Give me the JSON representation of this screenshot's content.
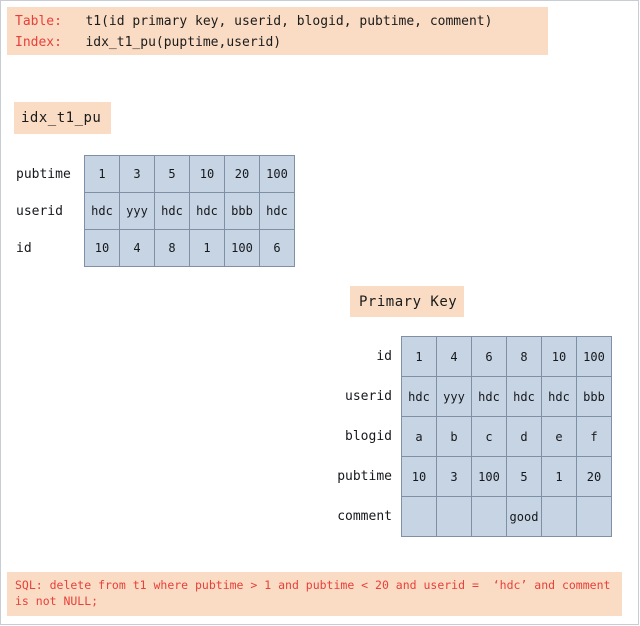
{
  "header": {
    "table_label": "Table:",
    "table_def": "t1(id primary key, userid, blogid, pubtime, comment)",
    "index_label": "Index:",
    "index_def": "idx_t1_pu(puptime,userid)"
  },
  "index_section": {
    "chip_label": "idx_t1_pu",
    "rows": [
      {
        "label": "pubtime",
        "values": [
          "1",
          "3",
          "5",
          "10",
          "20",
          "100"
        ]
      },
      {
        "label": "userid",
        "values": [
          "hdc",
          "yyy",
          "hdc",
          "hdc",
          "bbb",
          "hdc"
        ]
      },
      {
        "label": "id",
        "values": [
          "10",
          "4",
          "8",
          "1",
          "100",
          "6"
        ]
      }
    ]
  },
  "primary_key_section": {
    "chip_label": "Primary Key",
    "rows": [
      {
        "label": "id",
        "values": [
          "1",
          "4",
          "6",
          "8",
          "10",
          "100"
        ]
      },
      {
        "label": "userid",
        "values": [
          "hdc",
          "yyy",
          "hdc",
          "hdc",
          "hdc",
          "bbb"
        ]
      },
      {
        "label": "blogid",
        "values": [
          "a",
          "b",
          "c",
          "d",
          "e",
          "f"
        ]
      },
      {
        "label": "pubtime",
        "values": [
          "10",
          "3",
          "100",
          "5",
          "1",
          "20"
        ]
      },
      {
        "label": "comment",
        "values": [
          "",
          "",
          "",
          "good",
          "",
          ""
        ]
      }
    ]
  },
  "footer": {
    "sql_text": "SQL: delete from t1 where pubtime > 1 and pubtime < 20 and userid =  ‘hdc’ and comment is not NULL;"
  },
  "colors": {
    "banner_bg": "#fadcc4",
    "cell_bg": "#c6d4e4",
    "cell_border": "#7e8fa6",
    "keyword_red": "#e8403a",
    "text_dark": "#1b1b1b"
  }
}
